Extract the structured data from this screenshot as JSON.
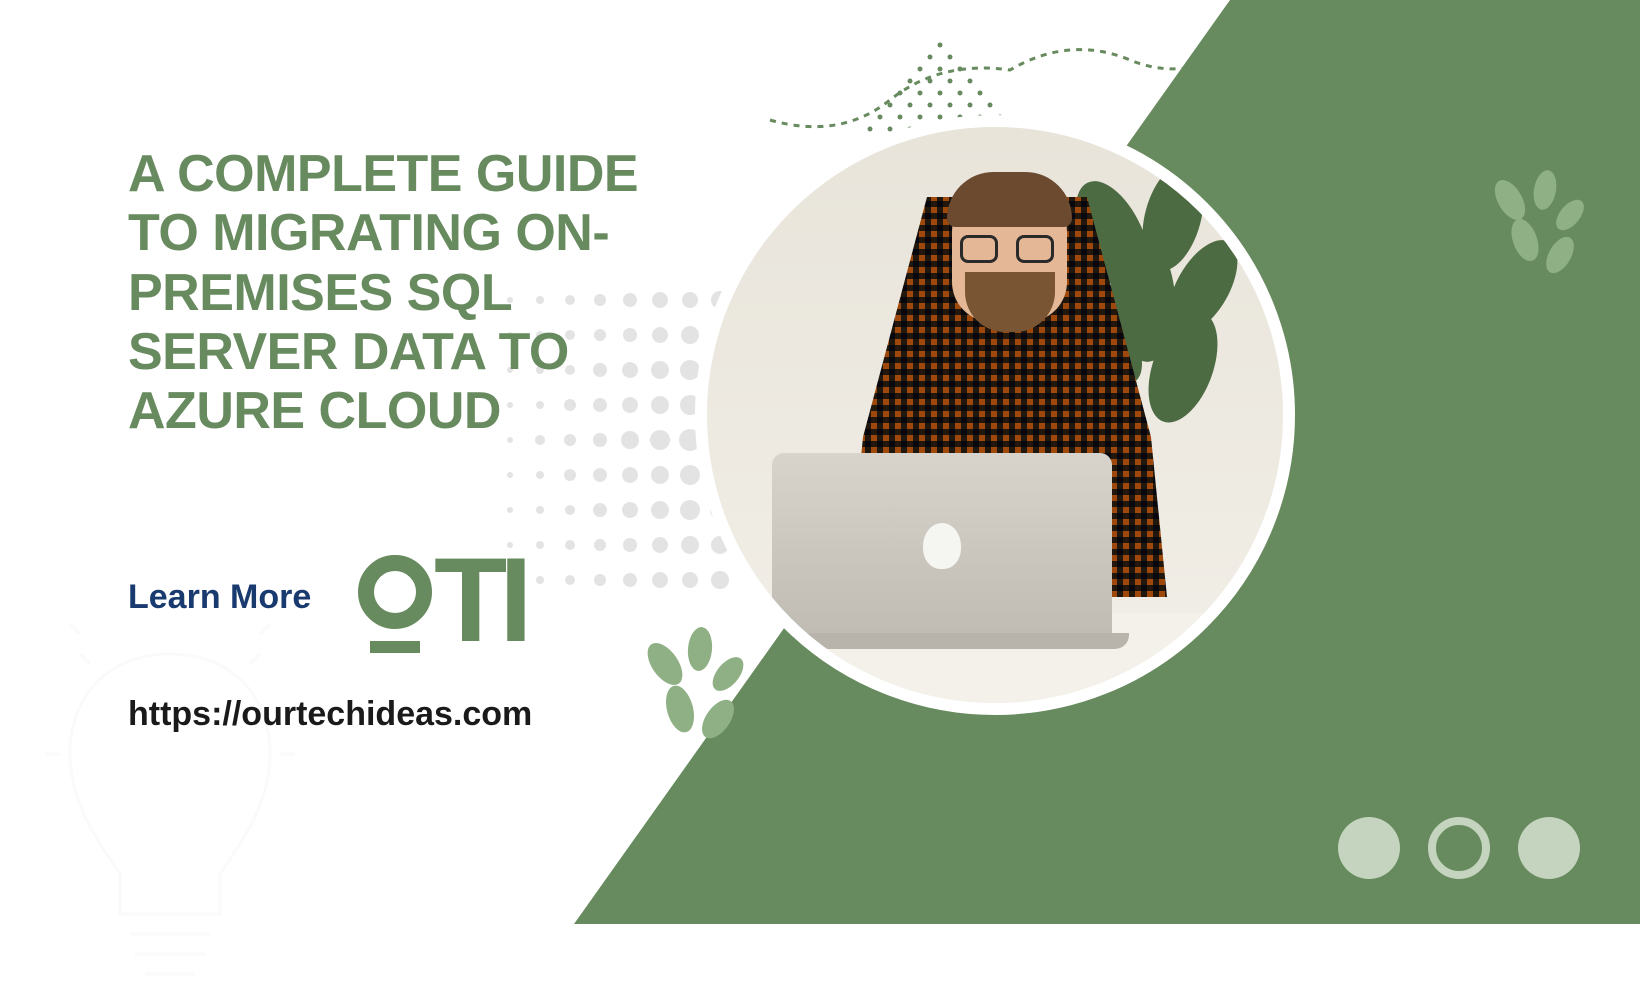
{
  "title": "A COMPLETE GUIDE TO MIGRATING ON-PREMISES SQL SERVER DATA TO AZURE CLOUD",
  "learn_more": "Learn More",
  "logo_text": "TI",
  "url": "https://ourtechideas.com",
  "colors": {
    "green": "#678a5e",
    "navy": "#193a6f",
    "light_green": "#c4d4be"
  }
}
